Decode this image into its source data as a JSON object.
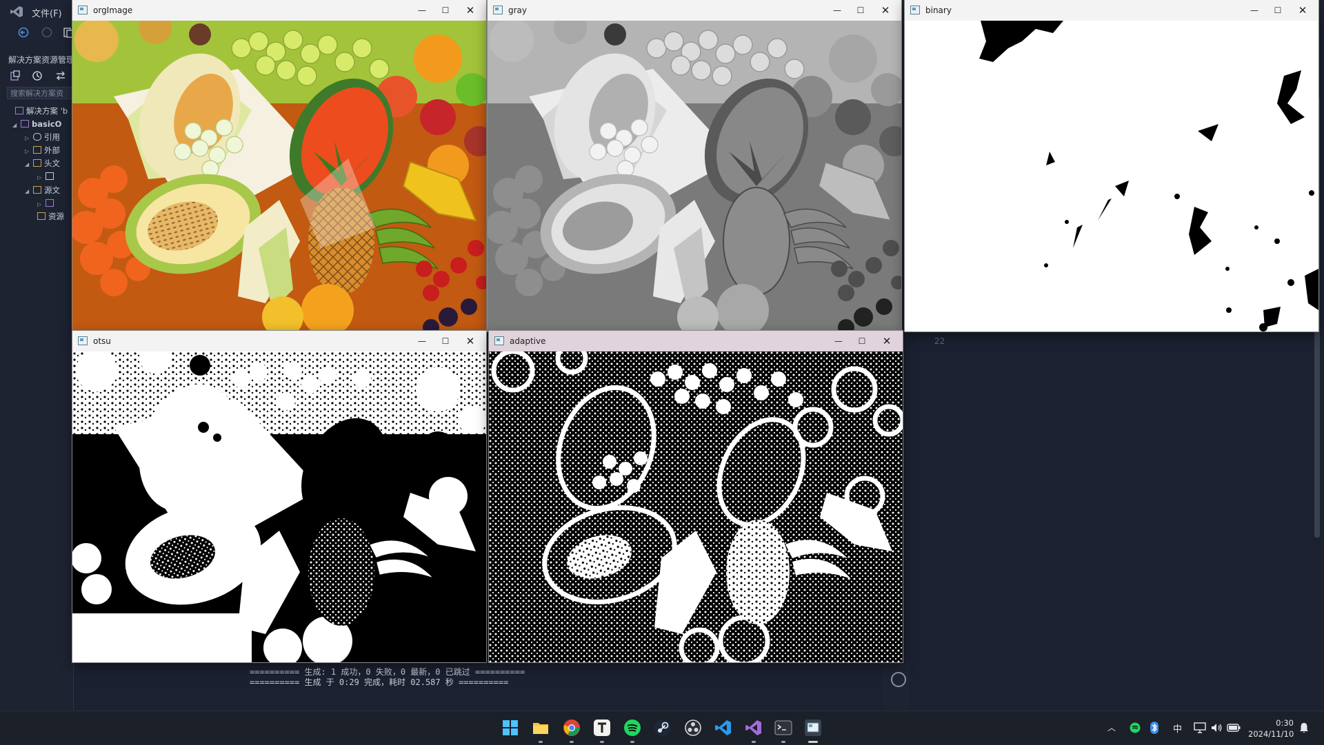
{
  "vs": {
    "menu_file": "文件(F)",
    "solution_explorer_title": "解决方案资源管理",
    "search_placeholder": "搜索解决方案资",
    "tree": [
      {
        "label": "解决方案 'b",
        "bold": false
      },
      {
        "label": "basicO",
        "bold": true
      },
      {
        "label": "引用",
        "bold": false
      },
      {
        "label": "外部",
        "bold": false
      },
      {
        "label": "头文",
        "bold": false
      },
      {
        "label": "",
        "bold": false
      },
      {
        "label": "源文",
        "bold": false
      },
      {
        "label": "",
        "bold": false
      },
      {
        "label": "资源",
        "bold": false
      }
    ],
    "line_number": "22",
    "output_lines": [
      "========== 生成: 1 成功，0 失败，0 最新，0 已跳过 ==========",
      "========== 生成 于 0:29 完成，耗时 02.587 秒 =========="
    ]
  },
  "windows": [
    {
      "title": "orgImage"
    },
    {
      "title": "gray"
    },
    {
      "title": "binary"
    },
    {
      "title": "otsu"
    },
    {
      "title": "adaptive"
    }
  ],
  "window_controls": {
    "minimize": "—",
    "maximize": "☐",
    "close": "✕"
  },
  "taskbar": {
    "apps": [
      "start-icon",
      "file-explorer-icon",
      "chrome-icon",
      "typora-icon",
      "spotify-icon",
      "steam-icon",
      "obs-icon",
      "vscode-icon",
      "visual-studio-icon",
      "terminal-icon",
      "opencv-window-icon"
    ],
    "tray": {
      "ime": "中",
      "time": "0:30",
      "date": "2024/11/10"
    }
  },
  "colors": {
    "active_titlebar": "#e1d3dc",
    "taskbar_bg": "#1c2028",
    "vs_bg": "#1a2232"
  }
}
